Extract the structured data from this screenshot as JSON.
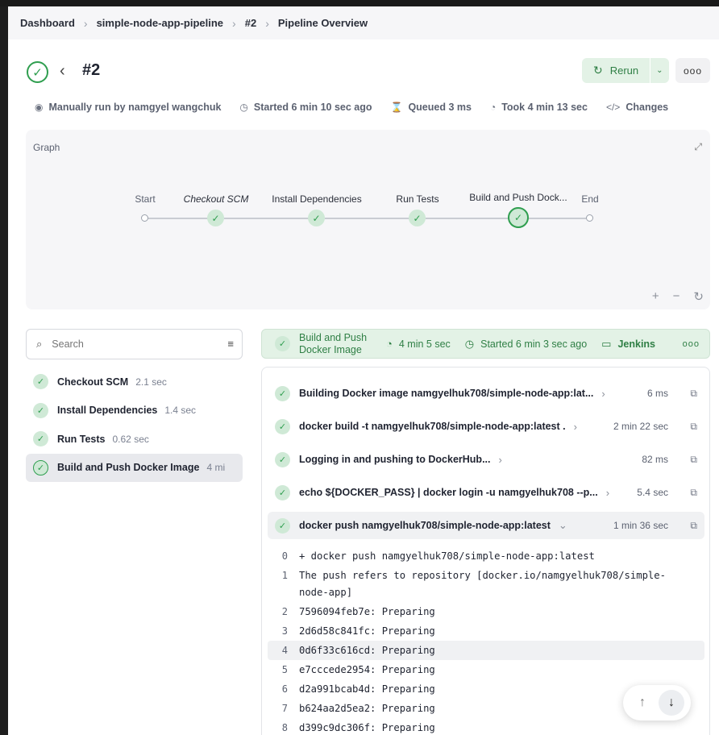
{
  "breadcrumb": [
    "Dashboard",
    "simple-node-app-pipeline",
    "#2",
    "Pipeline Overview"
  ],
  "header": {
    "title": "#2",
    "rerun_label": "Rerun",
    "status_color": "#2f9e4f"
  },
  "meta": {
    "run_by": "Manually run by namgyel wangchuk",
    "started": "Started 6 min 10 sec ago",
    "queued": "Queued 3 ms",
    "took": "Took 4 min 13 sec",
    "changes": "Changes"
  },
  "graph": {
    "title": "Graph",
    "nodes": {
      "start": "Start",
      "checkout": "Checkout SCM",
      "install": "Install Dependencies",
      "tests": "Run Tests",
      "build": "Build and Push Dock...",
      "end": "End"
    }
  },
  "search": {
    "placeholder": "Search"
  },
  "stages": [
    {
      "name": "Checkout SCM",
      "duration": "2.1 sec"
    },
    {
      "name": "Install Dependencies",
      "duration": "1.4 sec"
    },
    {
      "name": "Run Tests",
      "duration": "0.62 sec"
    },
    {
      "name": "Build and Push Docker Image",
      "duration": "4 mi"
    }
  ],
  "stage_header": {
    "name": "Build and Push Docker Image",
    "duration": "4 min 5 sec",
    "started": "Started 6 min 3 sec ago",
    "agent": "Jenkins"
  },
  "steps": [
    {
      "name": "Building Docker image namgyelhuk708/simple-node-app:lat...",
      "duration": "6 ms"
    },
    {
      "name": "docker build -t namgyelhuk708/simple-node-app:latest .",
      "duration": "2 min 22 sec"
    },
    {
      "name": "Logging in and pushing to DockerHub...",
      "duration": "82 ms"
    },
    {
      "name": "echo ${DOCKER_PASS} | docker login -u namgyelhuk708 --p...",
      "duration": "5.4 sec"
    },
    {
      "name": "docker push namgyelhuk708/simple-node-app:latest",
      "duration": "1 min 36 sec"
    }
  ],
  "log": [
    {
      "n": "0",
      "t": "+ docker push namgyelhuk708/simple-node-app:latest"
    },
    {
      "n": "1",
      "t": "The push refers to repository [docker.io/namgyelhuk708/simple-node-app]"
    },
    {
      "n": "2",
      "t": "7596094feb7e: Preparing"
    },
    {
      "n": "3",
      "t": "2d6d58c841fc: Preparing"
    },
    {
      "n": "4",
      "t": "0d6f33c616cd: Preparing"
    },
    {
      "n": "5",
      "t": "e7cccede2954: Preparing"
    },
    {
      "n": "6",
      "t": "d2a991bcab4d: Preparing"
    },
    {
      "n": "7",
      "t": "b624aa2d5ea2: Preparing"
    },
    {
      "n": "8",
      "t": "d399c9dc306f: Preparing"
    }
  ]
}
